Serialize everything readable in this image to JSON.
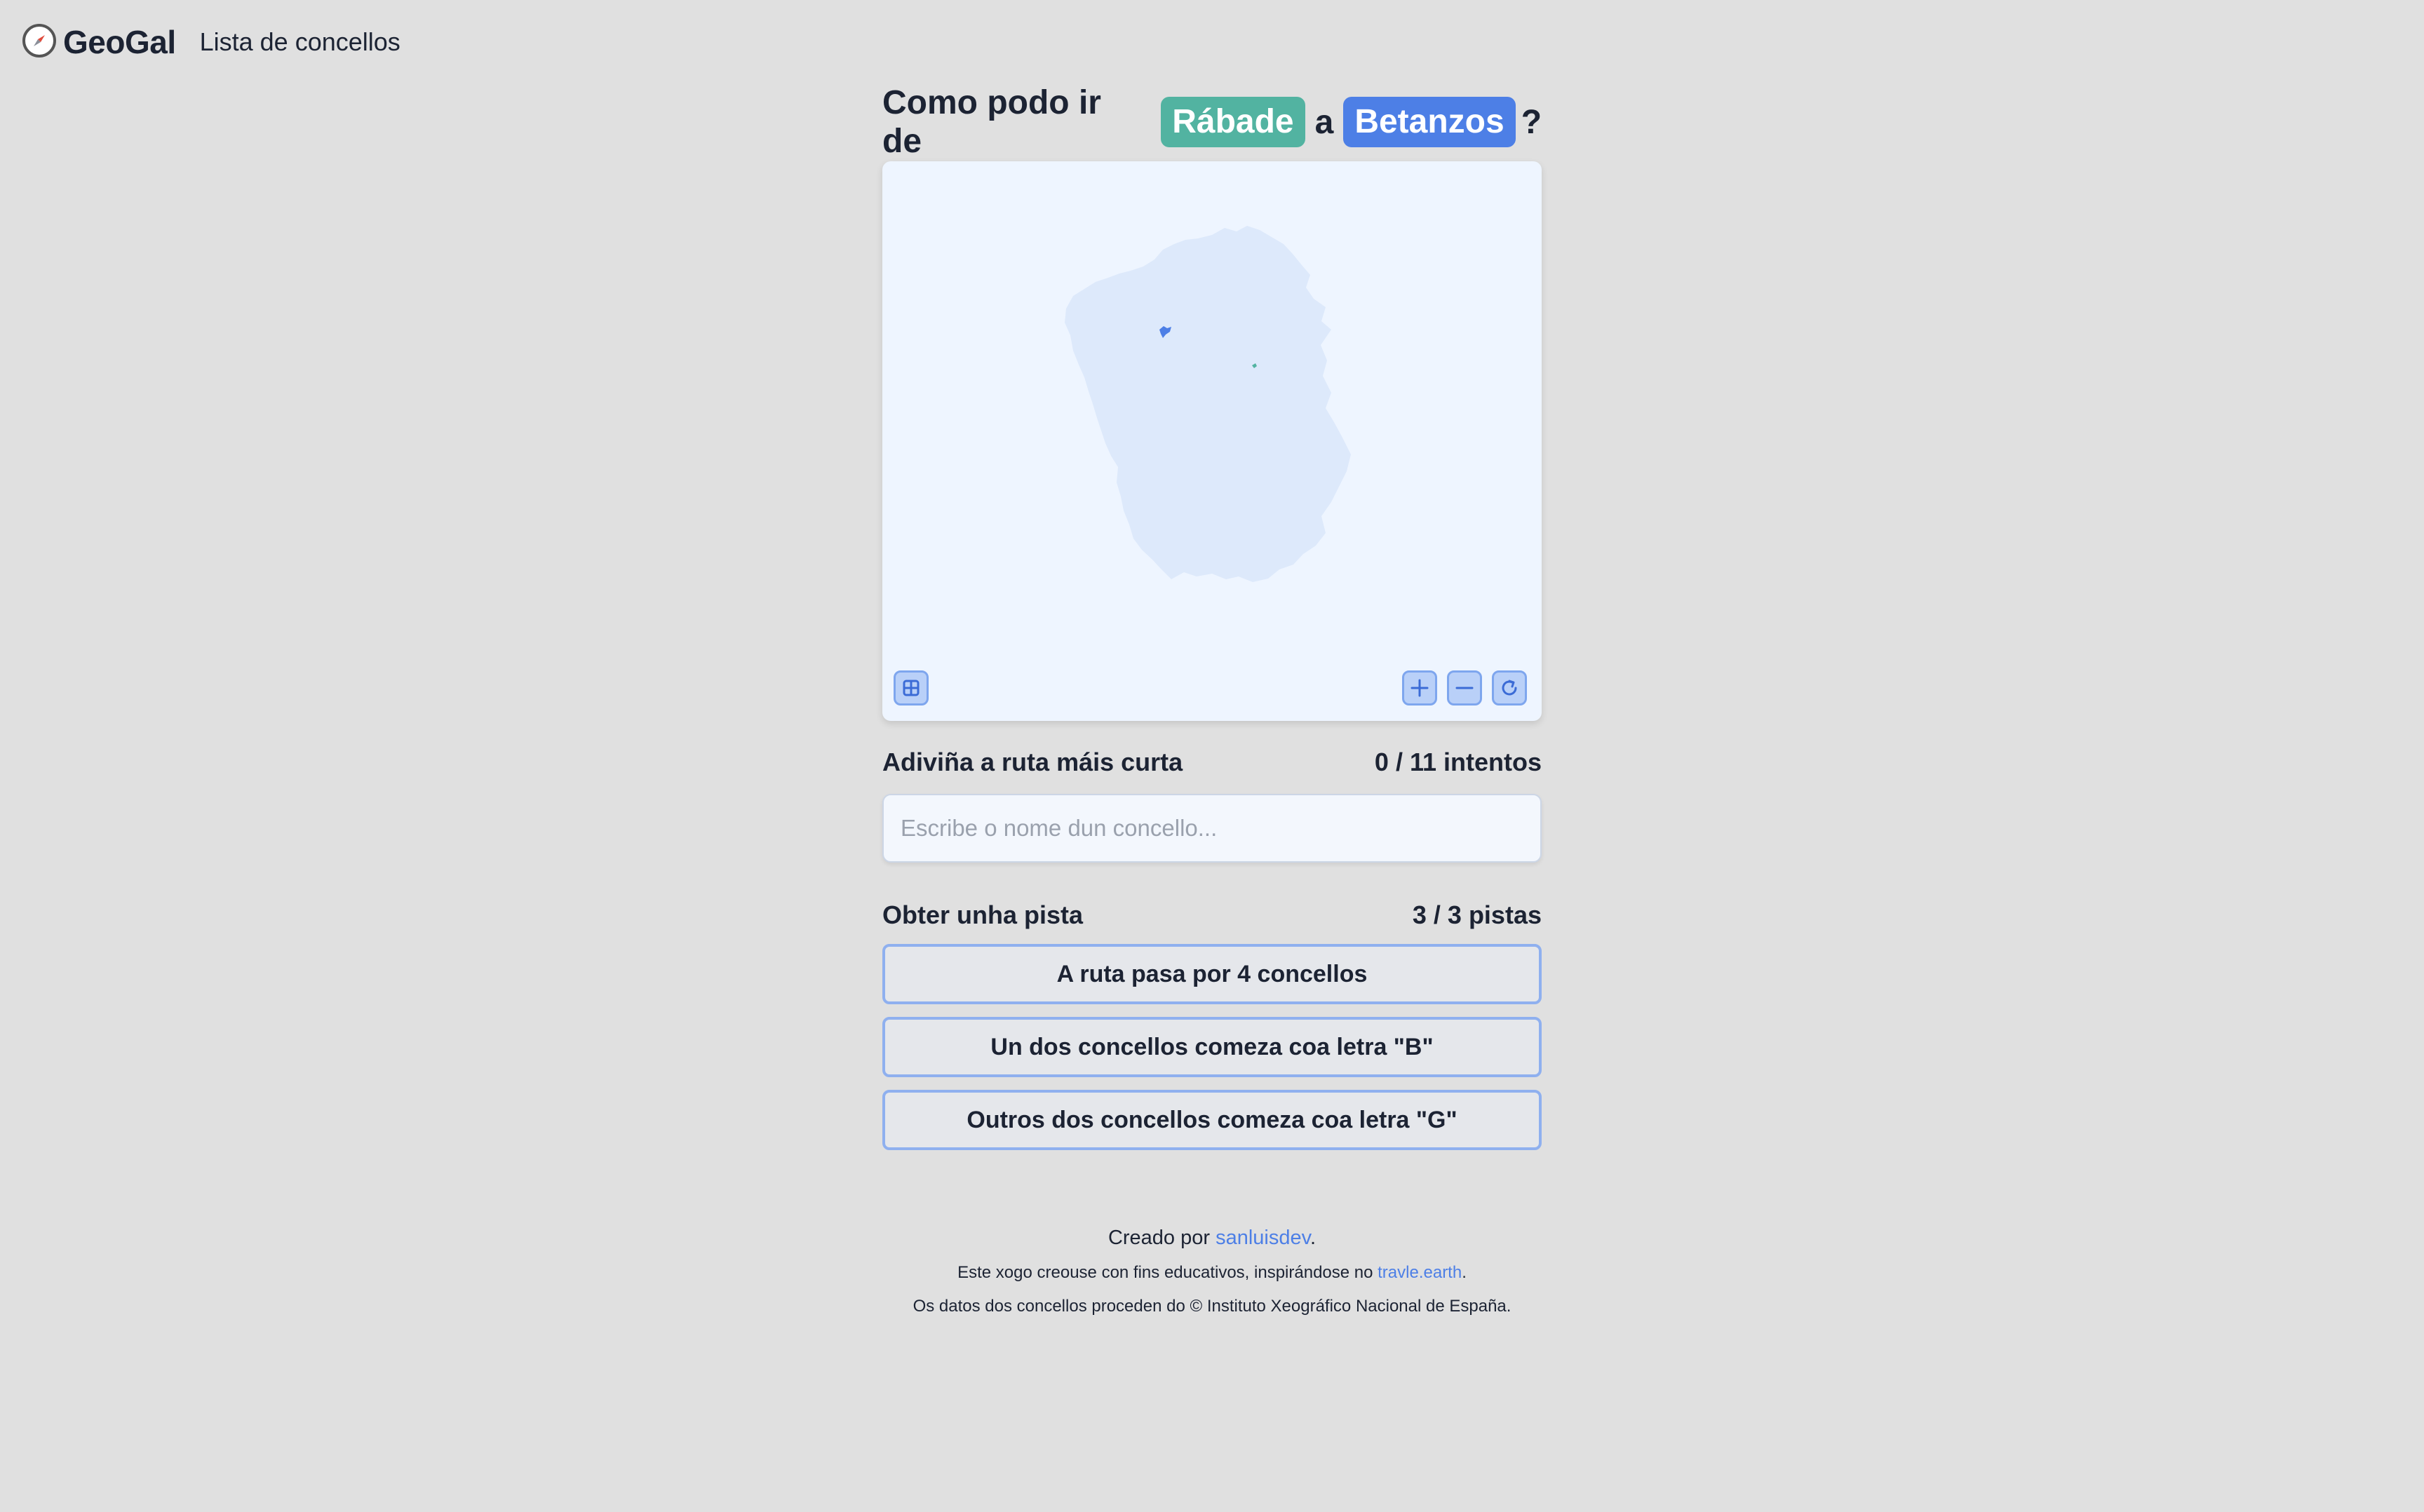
{
  "header": {
    "brand": "GeoGal",
    "nav_link": "Lista de concellos"
  },
  "question": {
    "prefix": "Como podo ir de",
    "origin": "Rábade",
    "connector": "a",
    "destination": "Betanzos",
    "suffix": "?"
  },
  "map": {
    "region_color": "#dde9fb",
    "origin_color": "#52b3a1",
    "destination_color": "#4d7fe6",
    "controls": [
      "layers-icon",
      "plus-icon",
      "minus-icon",
      "reset-icon"
    ]
  },
  "guess": {
    "label": "Adiviña a ruta máis curta",
    "attempts": "0 / 11 intentos",
    "placeholder": "Escribe o nome dun concello..."
  },
  "hints": {
    "label": "Obter unha pista",
    "count": "3 / 3 pistas",
    "items": [
      "A ruta pasa por 4 concellos",
      "Un dos concellos comeza coa letra \"B\"",
      "Outros dos concellos comeza coa letra \"G\""
    ]
  },
  "footer": {
    "created_by": "Creado por",
    "author": "sanluisdev",
    "period": ".",
    "edu_text": "Este xogo creouse con fins educativos, inspirándose no",
    "inspiration": "travle.earth",
    "data_text": "Os datos dos concellos proceden do © Instituto Xeográfico Nacional de España."
  }
}
